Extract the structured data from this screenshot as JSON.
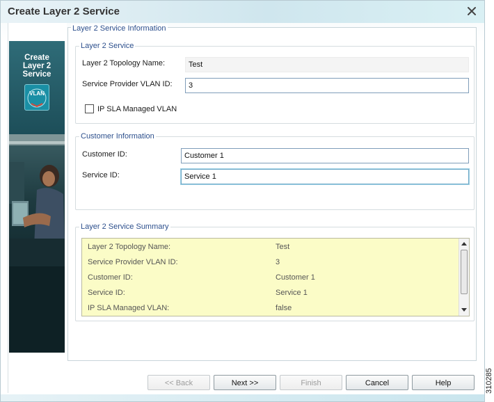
{
  "window": {
    "title": "Create Layer 2 Service"
  },
  "banner": {
    "title_lines": [
      "Create",
      "Layer 2",
      "Service"
    ],
    "badge": "VLAN"
  },
  "main": {
    "legend": "Layer 2 Service Information"
  },
  "layer2_service": {
    "legend": "Layer 2 Service",
    "topology_label": "Layer 2 Topology Name:",
    "topology_value": "Test",
    "vlan_label": "Service Provider VLAN ID:",
    "vlan_value": "3",
    "ipsla_label": "IP SLA Managed VLAN",
    "ipsla_checked": false
  },
  "customer_info": {
    "legend": "Customer Information",
    "customer_label": "Customer ID:",
    "customer_value": "Customer 1",
    "service_label": "Service ID:",
    "service_value": "Service 1"
  },
  "summary": {
    "legend": "Layer 2 Service Summary",
    "rows": [
      {
        "label": "Layer 2 Topology Name:",
        "value": "Test"
      },
      {
        "label": "Service Provider VLAN ID:",
        "value": "3"
      },
      {
        "label": "Customer ID:",
        "value": "Customer 1"
      },
      {
        "label": "Service ID:",
        "value": "Service 1"
      },
      {
        "label": "IP SLA Managed VLAN:",
        "value": "false"
      }
    ]
  },
  "buttons": {
    "back": "<< Back",
    "next": "Next >>",
    "finish": "Finish",
    "cancel": "Cancel",
    "help": "Help"
  },
  "figure_id": "310285",
  "colors": {
    "summary_bg": "#fbfcc7",
    "legend_text": "#2c4f8c",
    "banner_teal": "#1d4e59"
  },
  "icons": {
    "close": "close-icon",
    "badge": "vlan-icon"
  }
}
